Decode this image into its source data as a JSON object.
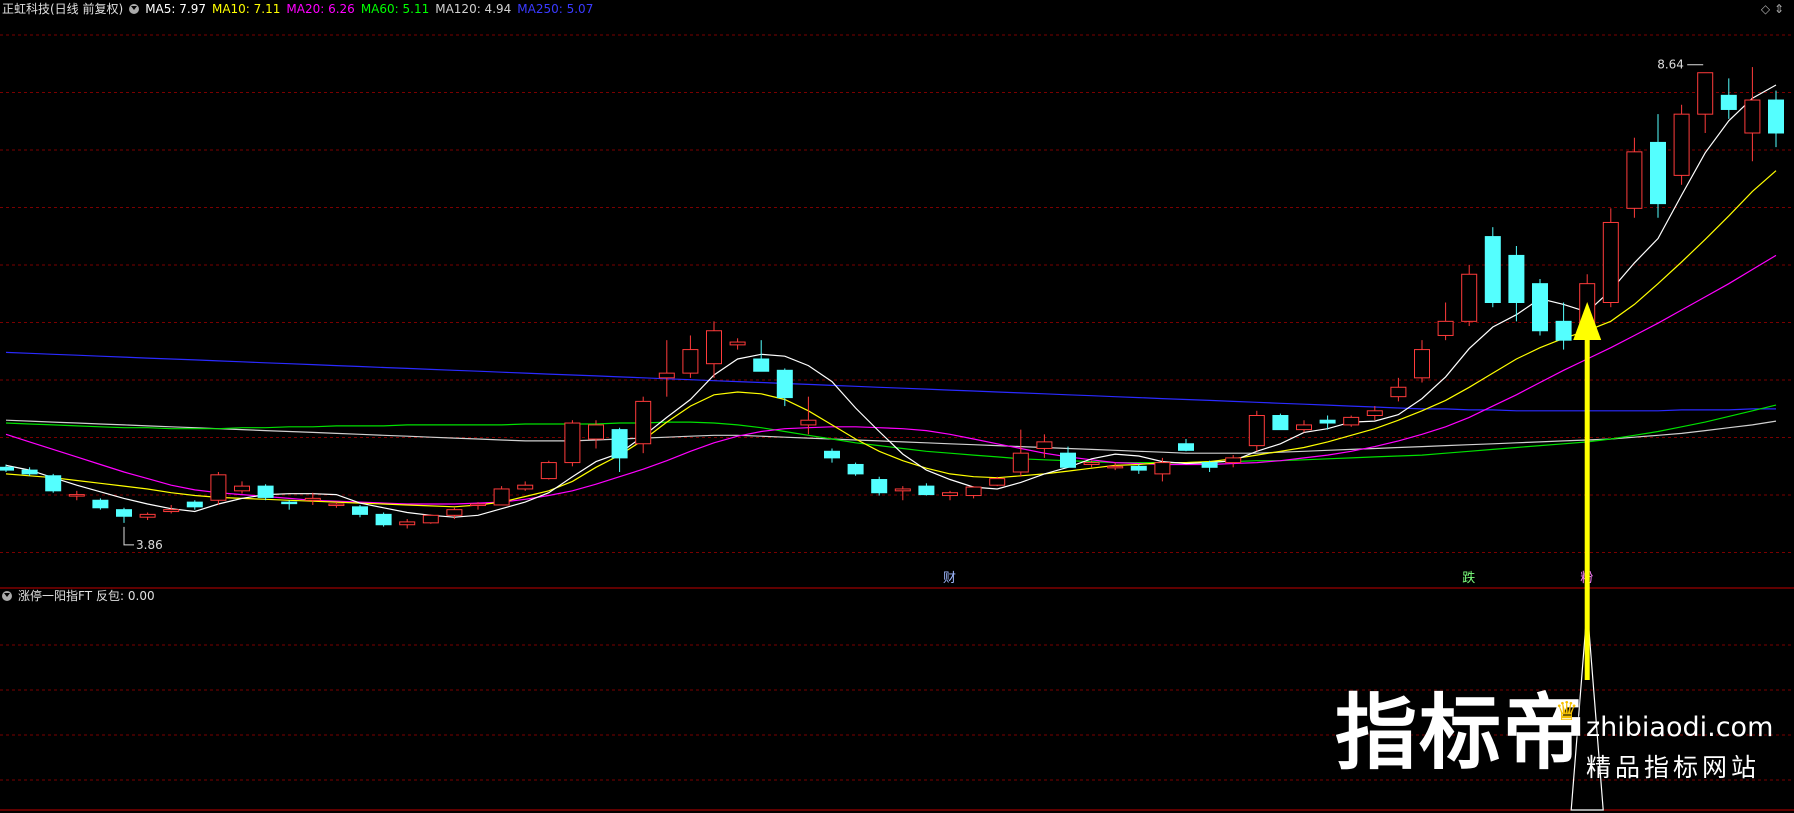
{
  "header": {
    "title": "正虹科技(日线 前复权)",
    "ma": [
      {
        "label": "MA5: 7.97",
        "color": "#ffffff"
      },
      {
        "label": "MA10: 7.11",
        "color": "#ffff00"
      },
      {
        "label": "MA20: 6.26",
        "color": "#ff00ff"
      },
      {
        "label": "MA60: 5.11",
        "color": "#00ff00"
      },
      {
        "label": "MA120: 4.94",
        "color": "#d0d0d0"
      },
      {
        "label": "MA250: 5.07",
        "color": "#2a2aff"
      }
    ]
  },
  "sub_header": {
    "title": "涨停一阳指FT",
    "value_label": "反包: 0.00"
  },
  "annotations": {
    "high_label": "8.64",
    "low_label": "3.86",
    "marker_cai": "财",
    "marker_die": "跌",
    "marker_right": "粉"
  },
  "watermark": {
    "big": "指标帝",
    "url": "zhibiaodi.com",
    "sub": "精品指标网站"
  },
  "colors": {
    "up": "#ff3b3b",
    "down": "#54ffff",
    "grid": "#7a0000",
    "arrow": "#ffff00"
  },
  "chart_data": {
    "type": "candlestick",
    "ohlc": [
      [
        4.45,
        4.48,
        4.4,
        4.42
      ],
      [
        4.42,
        4.45,
        4.36,
        4.38
      ],
      [
        4.36,
        4.38,
        4.18,
        4.2
      ],
      [
        4.15,
        4.2,
        4.1,
        4.16
      ],
      [
        4.1,
        4.12,
        4.0,
        4.02
      ],
      [
        4.0,
        4.02,
        3.86,
        3.93
      ],
      [
        3.92,
        3.97,
        3.89,
        3.95
      ],
      [
        3.98,
        4.05,
        3.96,
        4.0
      ],
      [
        4.08,
        4.1,
        4.0,
        4.03
      ],
      [
        4.1,
        4.4,
        4.05,
        4.37
      ],
      [
        4.2,
        4.3,
        4.17,
        4.25
      ],
      [
        4.25,
        4.27,
        4.1,
        4.13
      ],
      [
        4.08,
        4.1,
        4.0,
        4.07
      ],
      [
        4.1,
        4.18,
        4.05,
        4.12
      ],
      [
        4.05,
        4.08,
        4.02,
        4.06
      ],
      [
        4.03,
        4.05,
        3.92,
        3.95
      ],
      [
        3.95,
        3.97,
        3.82,
        3.84
      ],
      [
        3.84,
        3.9,
        3.8,
        3.87
      ],
      [
        3.86,
        3.95,
        3.85,
        3.94
      ],
      [
        3.94,
        4.02,
        3.9,
        4.0
      ],
      [
        4.05,
        4.08,
        4.0,
        4.06
      ],
      [
        4.05,
        4.25,
        4.05,
        4.22
      ],
      [
        4.22,
        4.3,
        4.2,
        4.26
      ],
      [
        4.33,
        4.52,
        4.32,
        4.5
      ],
      [
        4.5,
        4.95,
        4.46,
        4.92
      ],
      [
        4.75,
        4.95,
        4.65,
        4.9
      ],
      [
        4.85,
        4.87,
        4.4,
        4.55
      ],
      [
        4.7,
        5.2,
        4.6,
        5.15
      ],
      [
        5.4,
        5.8,
        5.2,
        5.45
      ],
      [
        5.45,
        5.85,
        5.4,
        5.7
      ],
      [
        5.55,
        6.0,
        5.4,
        5.9
      ],
      [
        5.75,
        5.82,
        5.7,
        5.78
      ],
      [
        5.6,
        5.8,
        5.5,
        5.47
      ],
      [
        5.48,
        5.5,
        5.1,
        5.19
      ],
      [
        4.9,
        5.2,
        4.8,
        4.95
      ],
      [
        4.62,
        4.65,
        4.5,
        4.55
      ],
      [
        4.48,
        4.5,
        4.36,
        4.38
      ],
      [
        4.32,
        4.35,
        4.15,
        4.18
      ],
      [
        4.2,
        4.25,
        4.1,
        4.22
      ],
      [
        4.25,
        4.28,
        4.15,
        4.16
      ],
      [
        4.15,
        4.2,
        4.1,
        4.18
      ],
      [
        4.15,
        4.25,
        4.12,
        4.24
      ],
      [
        4.26,
        4.35,
        4.25,
        4.33
      ],
      [
        4.4,
        4.85,
        4.35,
        4.6
      ],
      [
        4.65,
        4.8,
        4.55,
        4.72
      ],
      [
        4.6,
        4.67,
        4.45,
        4.45
      ],
      [
        4.48,
        4.52,
        4.45,
        4.5
      ],
      [
        4.45,
        4.5,
        4.42,
        4.46
      ],
      [
        4.46,
        4.48,
        4.38,
        4.42
      ],
      [
        4.38,
        4.55,
        4.3,
        4.5
      ],
      [
        4.7,
        4.75,
        4.62,
        4.63
      ],
      [
        4.5,
        4.52,
        4.4,
        4.45
      ],
      [
        4.5,
        4.58,
        4.45,
        4.55
      ],
      [
        4.68,
        5.05,
        4.62,
        5.0
      ],
      [
        5.0,
        5.02,
        4.85,
        4.85
      ],
      [
        4.85,
        4.95,
        4.82,
        4.9
      ],
      [
        4.95,
        5.0,
        4.85,
        4.92
      ],
      [
        4.9,
        5.0,
        4.88,
        4.98
      ],
      [
        5.0,
        5.1,
        4.95,
        5.05
      ],
      [
        5.2,
        5.4,
        5.15,
        5.3
      ],
      [
        5.4,
        5.8,
        5.35,
        5.7
      ],
      [
        5.85,
        6.2,
        5.8,
        6.0
      ],
      [
        6.0,
        6.6,
        5.95,
        6.5
      ],
      [
        6.9,
        7.0,
        6.15,
        6.2
      ],
      [
        6.7,
        6.8,
        6.0,
        6.2
      ],
      [
        6.4,
        6.45,
        5.85,
        5.9
      ],
      [
        6.0,
        6.2,
        5.7,
        5.8
      ],
      [
        5.9,
        6.5,
        5.85,
        6.4
      ],
      [
        6.2,
        7.2,
        6.15,
        7.05
      ],
      [
        7.2,
        7.95,
        7.1,
        7.8
      ],
      [
        7.9,
        8.2,
        7.1,
        7.25
      ],
      [
        7.55,
        8.3,
        7.45,
        8.2
      ],
      [
        8.2,
        8.64,
        8.0,
        8.64
      ],
      [
        8.4,
        8.58,
        8.15,
        8.25
      ],
      [
        8.0,
        8.7,
        7.7,
        8.35
      ],
      [
        8.35,
        8.45,
        7.85,
        8.0
      ]
    ],
    "ma5": [
      4.47,
      4.42,
      4.34,
      4.26,
      4.19,
      4.12,
      4.06,
      4.01,
      3.98,
      4.06,
      4.12,
      4.16,
      4.17,
      4.17,
      4.16,
      4.07,
      4.02,
      3.97,
      3.94,
      3.92,
      3.94,
      4.01,
      4.08,
      4.18,
      4.35,
      4.51,
      4.6,
      4.78,
      4.98,
      5.17,
      5.43,
      5.6,
      5.65,
      5.63,
      5.53,
      5.36,
      5.08,
      4.83,
      4.59,
      4.42,
      4.32,
      4.24,
      4.22,
      4.29,
      4.38,
      4.45,
      4.54,
      4.59,
      4.57,
      4.51,
      4.49,
      4.5,
      4.52,
      4.62,
      4.7,
      4.82,
      4.86,
      4.93,
      4.94,
      5.01,
      5.18,
      5.41,
      5.71,
      5.94,
      6.07,
      6.24,
      6.18,
      6.1,
      6.33,
      6.62,
      6.88,
      7.34,
      7.79,
      8.13,
      8.37,
      8.51
    ],
    "ma10": [
      4.38,
      4.36,
      4.34,
      4.31,
      4.28,
      4.25,
      4.22,
      4.18,
      4.15,
      4.13,
      4.12,
      4.11,
      4.1,
      4.09,
      4.08,
      4.07,
      4.06,
      4.05,
      4.04,
      4.03,
      4.05,
      4.08,
      4.14,
      4.2,
      4.3,
      4.45,
      4.58,
      4.74,
      4.93,
      5.1,
      5.22,
      5.25,
      5.23,
      5.17,
      5.05,
      4.9,
      4.75,
      4.62,
      4.52,
      4.44,
      4.38,
      4.35,
      4.34,
      4.36,
      4.38,
      4.41,
      4.44,
      4.47,
      4.48,
      4.5,
      4.5,
      4.51,
      4.54,
      4.58,
      4.62,
      4.66,
      4.72,
      4.79,
      4.86,
      4.95,
      5.05,
      5.16,
      5.3,
      5.45,
      5.6,
      5.72,
      5.82,
      5.9,
      6.0,
      6.18,
      6.4,
      6.63,
      6.87,
      7.12,
      7.38,
      7.6
    ],
    "ma20": [
      4.8,
      4.72,
      4.64,
      4.56,
      4.48,
      4.4,
      4.33,
      4.26,
      4.21,
      4.18,
      4.16,
      4.14,
      4.12,
      4.1,
      4.09,
      4.08,
      4.07,
      4.06,
      4.06,
      4.06,
      4.07,
      4.08,
      4.11,
      4.15,
      4.2,
      4.27,
      4.35,
      4.43,
      4.52,
      4.62,
      4.71,
      4.78,
      4.83,
      4.86,
      4.87,
      4.88,
      4.88,
      4.87,
      4.86,
      4.84,
      4.8,
      4.75,
      4.7,
      4.65,
      4.6,
      4.56,
      4.53,
      4.5,
      4.49,
      4.48,
      4.48,
      4.48,
      4.49,
      4.5,
      4.52,
      4.55,
      4.58,
      4.62,
      4.67,
      4.73,
      4.8,
      4.88,
      4.98,
      5.1,
      5.22,
      5.35,
      5.48,
      5.6,
      5.72,
      5.85,
      5.98,
      6.12,
      6.26,
      6.4,
      6.55,
      6.7
    ],
    "ma60": [
      4.92,
      4.91,
      4.9,
      4.89,
      4.88,
      4.87,
      4.87,
      4.86,
      4.86,
      4.86,
      4.87,
      4.87,
      4.88,
      4.88,
      4.89,
      4.89,
      4.89,
      4.9,
      4.9,
      4.9,
      4.9,
      4.9,
      4.91,
      4.91,
      4.91,
      4.91,
      4.92,
      4.92,
      4.93,
      4.93,
      4.92,
      4.9,
      4.87,
      4.83,
      4.79,
      4.75,
      4.71,
      4.68,
      4.65,
      4.62,
      4.6,
      4.58,
      4.56,
      4.54,
      4.53,
      4.52,
      4.51,
      4.5,
      4.5,
      4.5,
      4.5,
      4.51,
      4.51,
      4.52,
      4.52,
      4.53,
      4.54,
      4.55,
      4.56,
      4.57,
      4.58,
      4.6,
      4.62,
      4.64,
      4.66,
      4.68,
      4.7,
      4.72,
      4.75,
      4.79,
      4.83,
      4.88,
      4.93,
      4.99,
      5.05,
      5.11
    ],
    "ma120": [
      4.95,
      4.94,
      4.93,
      4.92,
      4.91,
      4.9,
      4.89,
      4.88,
      4.87,
      4.86,
      4.85,
      4.84,
      4.83,
      4.82,
      4.81,
      4.8,
      4.79,
      4.78,
      4.77,
      4.76,
      4.75,
      4.74,
      4.73,
      4.73,
      4.73,
      4.74,
      4.75,
      4.76,
      4.77,
      4.78,
      4.79,
      4.79,
      4.78,
      4.77,
      4.76,
      4.75,
      4.74,
      4.73,
      4.72,
      4.71,
      4.7,
      4.69,
      4.68,
      4.67,
      4.66,
      4.65,
      4.64,
      4.63,
      4.62,
      4.61,
      4.6,
      4.6,
      4.6,
      4.6,
      4.61,
      4.62,
      4.63,
      4.64,
      4.65,
      4.66,
      4.67,
      4.68,
      4.69,
      4.7,
      4.71,
      4.72,
      4.73,
      4.74,
      4.75,
      4.77,
      4.79,
      4.81,
      4.84,
      4.87,
      4.9,
      4.94
    ],
    "ma250": [
      5.67,
      5.66,
      5.65,
      5.64,
      5.63,
      5.62,
      5.61,
      5.6,
      5.59,
      5.58,
      5.57,
      5.56,
      5.55,
      5.54,
      5.53,
      5.52,
      5.51,
      5.5,
      5.49,
      5.48,
      5.47,
      5.46,
      5.45,
      5.44,
      5.43,
      5.42,
      5.41,
      5.4,
      5.39,
      5.38,
      5.37,
      5.36,
      5.35,
      5.34,
      5.33,
      5.32,
      5.31,
      5.3,
      5.29,
      5.28,
      5.27,
      5.26,
      5.25,
      5.24,
      5.23,
      5.22,
      5.21,
      5.2,
      5.19,
      5.18,
      5.17,
      5.16,
      5.15,
      5.14,
      5.13,
      5.12,
      5.11,
      5.1,
      5.09,
      5.08,
      5.07,
      5.07,
      5.06,
      5.06,
      5.05,
      5.05,
      5.05,
      5.05,
      5.05,
      5.05,
      5.05,
      5.06,
      5.06,
      5.06,
      5.07,
      5.07
    ]
  }
}
